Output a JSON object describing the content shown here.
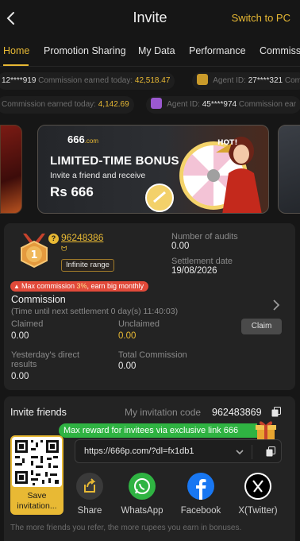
{
  "header": {
    "title": "Invite",
    "switch_label": "Switch to PC"
  },
  "tabs": [
    {
      "label": "Home",
      "active": true
    },
    {
      "label": "Promotion Sharing"
    },
    {
      "label": "My Data"
    },
    {
      "label": "Performance"
    },
    {
      "label": "Commiss"
    }
  ],
  "ticker": {
    "row1": [
      {
        "id": "12****919",
        "text": "Commission earned today:",
        "amount": "42,518.47"
      },
      {
        "label": "Agent ID:",
        "id": "27****321",
        "text": "Com"
      }
    ],
    "row2": [
      {
        "text": "Commission earned today:",
        "amount": "4,142.69"
      },
      {
        "label": "Agent ID:",
        "id": "45****974",
        "text": "Commission ear"
      }
    ]
  },
  "banner": {
    "logo": "666",
    "logo_suffix": ".com",
    "headline": "LIMITED-TIME BONUS",
    "subline": "Invite a friend and receive",
    "amount": "Rs 666",
    "hot": "HOT!"
  },
  "agent": {
    "level": "1",
    "id": "96248386",
    "copy_symbol": "ᗢ",
    "range_label": "Infinite range",
    "audits_label": "Number of audits",
    "audits_value": "0.00",
    "settlement_label": "Settlement date",
    "settlement_value": "19/08/2026",
    "promo_pill_prefix": "Max commission ",
    "promo_pill_highlight": "3%",
    "promo_pill_suffix": ", earn big monthly"
  },
  "commission": {
    "title": "Commission",
    "countdown": "(Time until next settlement 0 day(s) 11:40:03)",
    "claimed_label": "Claimed",
    "claimed_value": "0.00",
    "unclaimed_label": "Unclaimed",
    "unclaimed_value": "0.00",
    "claim_button": "Claim",
    "yesterday_label_1": "Yesterday's direct",
    "yesterday_label_2": "results",
    "yesterday_value": "0.00",
    "total_label": "Total Commission",
    "total_value": "0.00"
  },
  "invite": {
    "title": "Invite friends",
    "code_label": "My invitation code",
    "code_value": "962483869",
    "promo": "Max reward for invitees via exclusive link 666",
    "link": "https://666p.com/?dl=fx1db1",
    "save_label_1": "Save",
    "save_label_2": "invitation...",
    "share_items": [
      {
        "label": "Share",
        "icon": "share-icon"
      },
      {
        "label": "WhatsApp",
        "icon": "whatsapp-icon"
      },
      {
        "label": "Facebook",
        "icon": "facebook-icon"
      },
      {
        "label": "X(Twitter)",
        "icon": "x-twitter-icon"
      }
    ],
    "footer": "The more friends you refer, the more rupees you earn in bonuses."
  },
  "colors": {
    "accent": "#e8b934",
    "background": "#161616",
    "card": "#232323",
    "whatsapp": "#2fb342",
    "facebook": "#1877f2"
  }
}
